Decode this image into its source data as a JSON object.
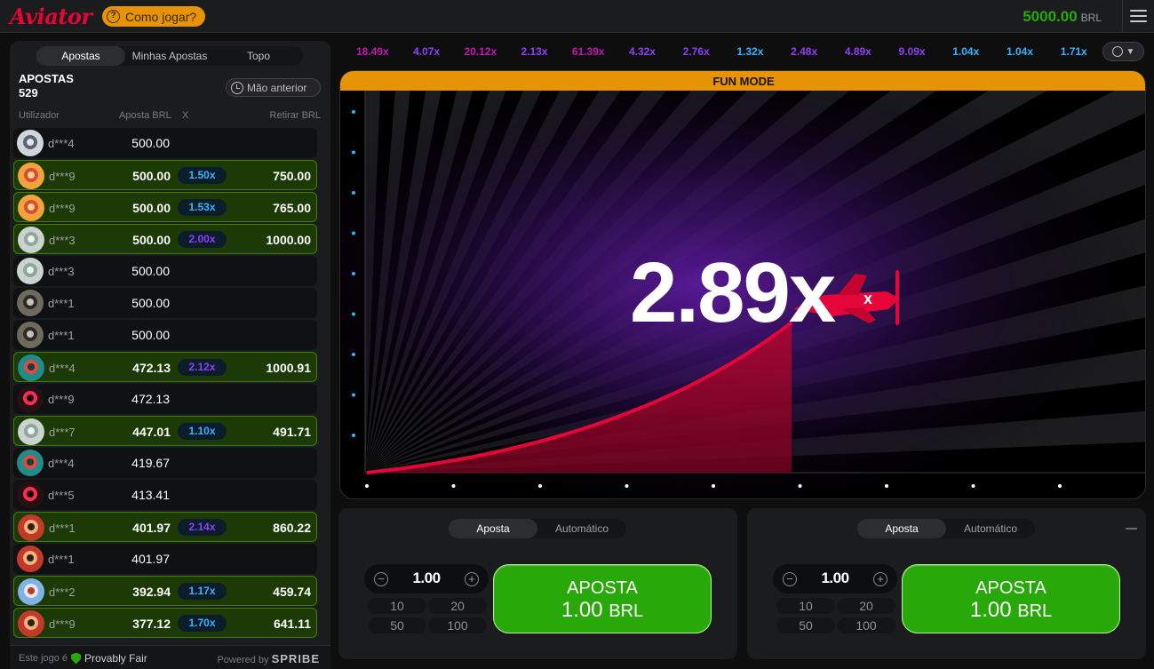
{
  "header": {
    "logo_text": "Aviator",
    "how_to_play": "Como jogar?",
    "balance": "5000.00",
    "currency": "BRL"
  },
  "sidebar": {
    "tabs": [
      "Apostas",
      "Minhas Apostas",
      "Topo"
    ],
    "bets_label": "APOSTAS",
    "bets_count": "529",
    "previous_button": "Mão anterior",
    "columns": {
      "user": "Utilizador",
      "bet": "Aposta BRL",
      "mult": "X",
      "cashout": "Retirar BRL"
    },
    "rows": [
      {
        "user": "d***4",
        "bet": "500.00",
        "mult": "",
        "cashout": "",
        "win": false,
        "avatar": "plane"
      },
      {
        "user": "d***9",
        "bet": "500.00",
        "mult": "1.50x",
        "cashout": "750.00",
        "win": true,
        "mult_color": "#34b4ff",
        "avatar": "cat"
      },
      {
        "user": "d***9",
        "bet": "500.00",
        "mult": "1.53x",
        "cashout": "765.00",
        "win": true,
        "mult_color": "#34b4ff",
        "avatar": "cat"
      },
      {
        "user": "d***3",
        "bet": "500.00",
        "mult": "2.00x",
        "cashout": "1000.00",
        "win": true,
        "mult_color": "#913ef8",
        "avatar": "money"
      },
      {
        "user": "d***3",
        "bet": "500.00",
        "mult": "",
        "cashout": "",
        "win": false,
        "avatar": "money"
      },
      {
        "user": "d***1",
        "bet": "500.00",
        "mult": "",
        "cashout": "",
        "win": false,
        "avatar": "raccoon"
      },
      {
        "user": "d***1",
        "bet": "500.00",
        "mult": "",
        "cashout": "",
        "win": false,
        "avatar": "raccoon"
      },
      {
        "user": "d***4",
        "bet": "472.13",
        "mult": "2.12x",
        "cashout": "1000.91",
        "win": true,
        "mult_color": "#913ef8",
        "avatar": "zombie"
      },
      {
        "user": "d***9",
        "bet": "472.13",
        "mult": "",
        "cashout": "",
        "win": false,
        "avatar": "devil"
      },
      {
        "user": "d***7",
        "bet": "447.01",
        "mult": "1.10x",
        "cashout": "491.71",
        "win": true,
        "mult_color": "#34b4ff",
        "avatar": "money"
      },
      {
        "user": "d***4",
        "bet": "419.67",
        "mult": "",
        "cashout": "",
        "win": false,
        "avatar": "zombie"
      },
      {
        "user": "d***5",
        "bet": "413.41",
        "mult": "",
        "cashout": "",
        "win": false,
        "avatar": "devil"
      },
      {
        "user": "d***1",
        "bet": "401.97",
        "mult": "2.14x",
        "cashout": "860.22",
        "win": true,
        "mult_color": "#913ef8",
        "avatar": "man"
      },
      {
        "user": "d***1",
        "bet": "401.97",
        "mult": "",
        "cashout": "",
        "win": false,
        "avatar": "man"
      },
      {
        "user": "d***2",
        "bet": "392.94",
        "mult": "1.17x",
        "cashout": "459.74",
        "win": true,
        "mult_color": "#34b4ff",
        "avatar": "plane2"
      },
      {
        "user": "d***9",
        "bet": "377.12",
        "mult": "1.70x",
        "cashout": "641.11",
        "win": true,
        "mult_color": "#34b4ff",
        "avatar": "man"
      }
    ],
    "footer_game_is": "Este jogo é",
    "footer_provably_fair": "Provably Fair",
    "footer_powered_by": "Powered by",
    "footer_brand": "SPRIBE"
  },
  "history": [
    {
      "value": "18.49x",
      "color": "#c017b4"
    },
    {
      "value": "4.07x",
      "color": "#913ef8"
    },
    {
      "value": "20.12x",
      "color": "#c017b4"
    },
    {
      "value": "2.13x",
      "color": "#913ef8"
    },
    {
      "value": "61.39x",
      "color": "#c017b4"
    },
    {
      "value": "4.32x",
      "color": "#913ef8"
    },
    {
      "value": "2.76x",
      "color": "#913ef8"
    },
    {
      "value": "1.32x",
      "color": "#34b4ff"
    },
    {
      "value": "2.48x",
      "color": "#913ef8"
    },
    {
      "value": "4.89x",
      "color": "#913ef8"
    },
    {
      "value": "9.09x",
      "color": "#913ef8"
    },
    {
      "value": "1.04x",
      "color": "#34b4ff"
    },
    {
      "value": "1.04x",
      "color": "#34b4ff"
    },
    {
      "value": "1.71x",
      "color": "#34b4ff"
    }
  ],
  "game": {
    "banner": "FUN MODE",
    "multiplier": "2.89x",
    "accent": "#e50539"
  },
  "bet_panels": [
    {
      "tabs": [
        "Aposta",
        "Automático"
      ],
      "amount": "1.00",
      "quick": [
        "10",
        "20",
        "50",
        "100"
      ],
      "button_label": "APOSTA",
      "button_amount": "1.00",
      "button_currency": "BRL"
    },
    {
      "tabs": [
        "Aposta",
        "Automático"
      ],
      "amount": "1.00",
      "quick": [
        "10",
        "20",
        "50",
        "100"
      ],
      "button_label": "APOSTA",
      "button_amount": "1.00",
      "button_currency": "BRL"
    }
  ]
}
